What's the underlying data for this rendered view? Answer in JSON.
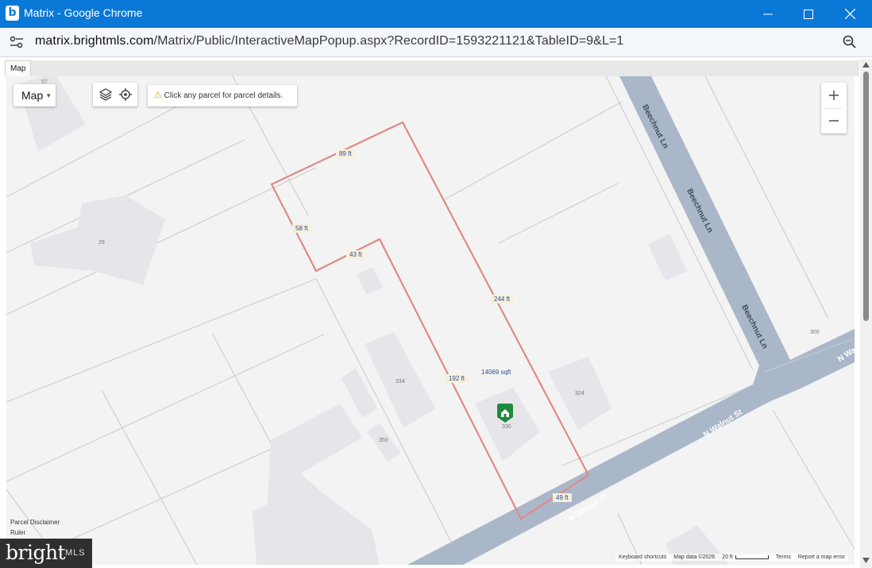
{
  "window": {
    "title": "Matrix - Google Chrome",
    "app_icon_letter": "b"
  },
  "address": {
    "host": "matrix.brightmls.com",
    "path": "/Matrix/Public/InteractiveMapPopup.aspx?RecordID=1593221121&TableID=9&L=1"
  },
  "tabs": {
    "map_tab": "Map"
  },
  "map_controls": {
    "map_type": "Map",
    "notice": "Click any parcel for parcel details."
  },
  "measurements": {
    "top": "89 ft",
    "left": "58 ft",
    "inner": "43 ft",
    "right": "244 ft",
    "middle": "192 ft",
    "bottom": "49 ft",
    "area": "14069 sqft"
  },
  "building_numbers": [
    "57",
    "29",
    "334",
    "324",
    "350",
    "330",
    "300"
  ],
  "streets": {
    "beechnut_1": "Beechnut Ln",
    "beechnut_2": "Beechnut Ln",
    "beechnut_3": "Beechnut Ln",
    "walnut_1": "N Walnut St",
    "walnut_2": "N Walnut St",
    "walnut_3": "N Wa"
  },
  "side_info": {
    "disclaimer": "Parcel Disclaimer",
    "ruler": "Ruler"
  },
  "footer": {
    "shortcuts": "Keyboard shortcuts",
    "map_data": "Map data ©2026",
    "scale": "20 ft",
    "terms": "Terms",
    "report": "Report a map error"
  },
  "logo": {
    "brand": "bright",
    "suffix": "MLS"
  },
  "colors": {
    "titlebar": "#0a78d7",
    "parcel_outline": "#e08a86",
    "road": "#aab7c9"
  }
}
